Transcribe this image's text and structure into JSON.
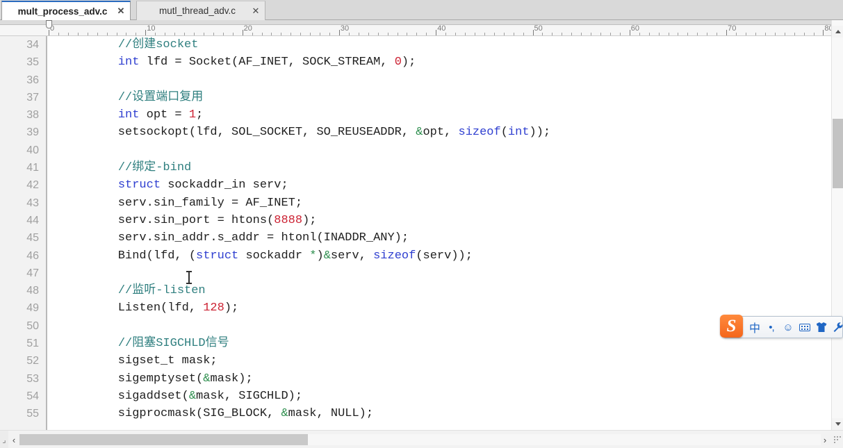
{
  "window": {
    "title": "mult_process_adv.c",
    "accent_color": "#2a6bbf"
  },
  "tabs": [
    {
      "label": "mult_process_adv.c",
      "close_label": "✕",
      "active": true
    },
    {
      "label": "mutl_thread_adv.c",
      "close_label": "✕",
      "active": false
    }
  ],
  "ruler": {
    "numbers": [
      "0",
      "10",
      "20",
      "30",
      "40",
      "50",
      "60",
      "70",
      "80"
    ],
    "unit_step": 10,
    "marker_position": "0"
  },
  "editor": {
    "first_visible_line": 34,
    "last_visible_line": 55,
    "language": "C",
    "lines": [
      {
        "no": "34",
        "tokens": [
          {
            "t": "    ",
            "c": "pln"
          },
          {
            "t": "//创建socket",
            "c": "cmt"
          }
        ]
      },
      {
        "no": "35",
        "tokens": [
          {
            "t": "    ",
            "c": "pln"
          },
          {
            "t": "int",
            "c": "kw"
          },
          {
            "t": " lfd = Socket(AF_INET, SOCK_STREAM, ",
            "c": "pln"
          },
          {
            "t": "0",
            "c": "num"
          },
          {
            "t": ");",
            "c": "pln"
          }
        ]
      },
      {
        "no": "36",
        "tokens": []
      },
      {
        "no": "37",
        "tokens": [
          {
            "t": "    ",
            "c": "pln"
          },
          {
            "t": "//设置端口复用",
            "c": "cmt"
          }
        ]
      },
      {
        "no": "38",
        "tokens": [
          {
            "t": "    ",
            "c": "pln"
          },
          {
            "t": "int",
            "c": "kw"
          },
          {
            "t": " opt = ",
            "c": "pln"
          },
          {
            "t": "1",
            "c": "num"
          },
          {
            "t": ";",
            "c": "pln"
          }
        ]
      },
      {
        "no": "39",
        "tokens": [
          {
            "t": "    setsockopt(lfd, SOL_SOCKET, SO_REUSEADDR, ",
            "c": "pln"
          },
          {
            "t": "&",
            "c": "op"
          },
          {
            "t": "opt, ",
            "c": "pln"
          },
          {
            "t": "sizeof",
            "c": "kw"
          },
          {
            "t": "(",
            "c": "pln"
          },
          {
            "t": "int",
            "c": "kw"
          },
          {
            "t": "));",
            "c": "pln"
          }
        ]
      },
      {
        "no": "40",
        "tokens": []
      },
      {
        "no": "41",
        "tokens": [
          {
            "t": "    ",
            "c": "pln"
          },
          {
            "t": "//绑定-bind",
            "c": "cmt"
          }
        ]
      },
      {
        "no": "42",
        "tokens": [
          {
            "t": "    ",
            "c": "pln"
          },
          {
            "t": "struct",
            "c": "kw"
          },
          {
            "t": " sockaddr_in serv;",
            "c": "pln"
          }
        ]
      },
      {
        "no": "43",
        "tokens": [
          {
            "t": "    serv.sin_family = AF_INET;",
            "c": "pln"
          }
        ]
      },
      {
        "no": "44",
        "tokens": [
          {
            "t": "    serv.sin_port = htons(",
            "c": "pln"
          },
          {
            "t": "8888",
            "c": "num"
          },
          {
            "t": ");",
            "c": "pln"
          }
        ]
      },
      {
        "no": "45",
        "tokens": [
          {
            "t": "    serv.sin_addr.s_addr = htonl(INADDR_ANY);",
            "c": "pln"
          }
        ]
      },
      {
        "no": "46",
        "tokens": [
          {
            "t": "    Bind(lfd, (",
            "c": "pln"
          },
          {
            "t": "struct",
            "c": "kw"
          },
          {
            "t": " sockaddr ",
            "c": "pln"
          },
          {
            "t": "*",
            "c": "op"
          },
          {
            "t": ")",
            "c": "pln"
          },
          {
            "t": "&",
            "c": "op"
          },
          {
            "t": "serv, ",
            "c": "pln"
          },
          {
            "t": "sizeof",
            "c": "kw"
          },
          {
            "t": "(serv));",
            "c": "pln"
          }
        ]
      },
      {
        "no": "47",
        "tokens": []
      },
      {
        "no": "48",
        "tokens": [
          {
            "t": "    ",
            "c": "pln"
          },
          {
            "t": "//监听-listen",
            "c": "cmt"
          }
        ]
      },
      {
        "no": "49",
        "tokens": [
          {
            "t": "    Listen(lfd, ",
            "c": "pln"
          },
          {
            "t": "128",
            "c": "num"
          },
          {
            "t": ");",
            "c": "pln"
          }
        ]
      },
      {
        "no": "50",
        "tokens": []
      },
      {
        "no": "51",
        "tokens": [
          {
            "t": "    ",
            "c": "pln"
          },
          {
            "t": "//阻塞SIGCHLD信号",
            "c": "cmt"
          }
        ]
      },
      {
        "no": "52",
        "tokens": [
          {
            "t": "    sigset_t mask;",
            "c": "pln"
          }
        ]
      },
      {
        "no": "53",
        "tokens": [
          {
            "t": "    sigemptyset(",
            "c": "pln"
          },
          {
            "t": "&",
            "c": "op"
          },
          {
            "t": "mask);",
            "c": "pln"
          }
        ]
      },
      {
        "no": "54",
        "tokens": [
          {
            "t": "    sigaddset(",
            "c": "pln"
          },
          {
            "t": "&",
            "c": "op"
          },
          {
            "t": "mask, SIGCHLD);",
            "c": "pln"
          }
        ]
      },
      {
        "no": "55",
        "tokens": [
          {
            "t": "    sigprocmask(SIG_BLOCK, ",
            "c": "pln"
          },
          {
            "t": "&",
            "c": "op"
          },
          {
            "t": "mask, NULL);",
            "c": "pln"
          }
        ]
      }
    ],
    "colors": {
      "comment": "#2f7f7f",
      "keyword": "#2f3fd0",
      "number": "#cc2233",
      "operator": "#2f8f4f",
      "plain": "#1f1f1f",
      "background": "#ffffff",
      "gutter_background": "#f2f2f2",
      "line_number": "#a0a0a0"
    }
  },
  "scrollbars": {
    "vertical": {
      "up_arrow": "▲",
      "down_arrow": "▼",
      "thumb_top_pct": 24,
      "thumb_height_pct": 17
    },
    "horizontal": {
      "left_arrow": "‹",
      "right_arrow": "›",
      "thumb_left_pct": 0,
      "thumb_width_pct": 36
    }
  },
  "ime_toolbar": {
    "name": "Sogou Pinyin",
    "logo_text": "S",
    "logo_color": "#f4661b",
    "icon_color": "#1f66c4",
    "buttons": [
      {
        "name": "input-mode-chinese",
        "label": "中"
      },
      {
        "name": "punctuation-mode",
        "label": "•,"
      },
      {
        "name": "emoji-panel",
        "label": "☺"
      },
      {
        "name": "soft-keyboard",
        "label": ""
      },
      {
        "name": "skin-selector",
        "label": ""
      },
      {
        "name": "toolbox",
        "label": "🔧"
      }
    ]
  }
}
